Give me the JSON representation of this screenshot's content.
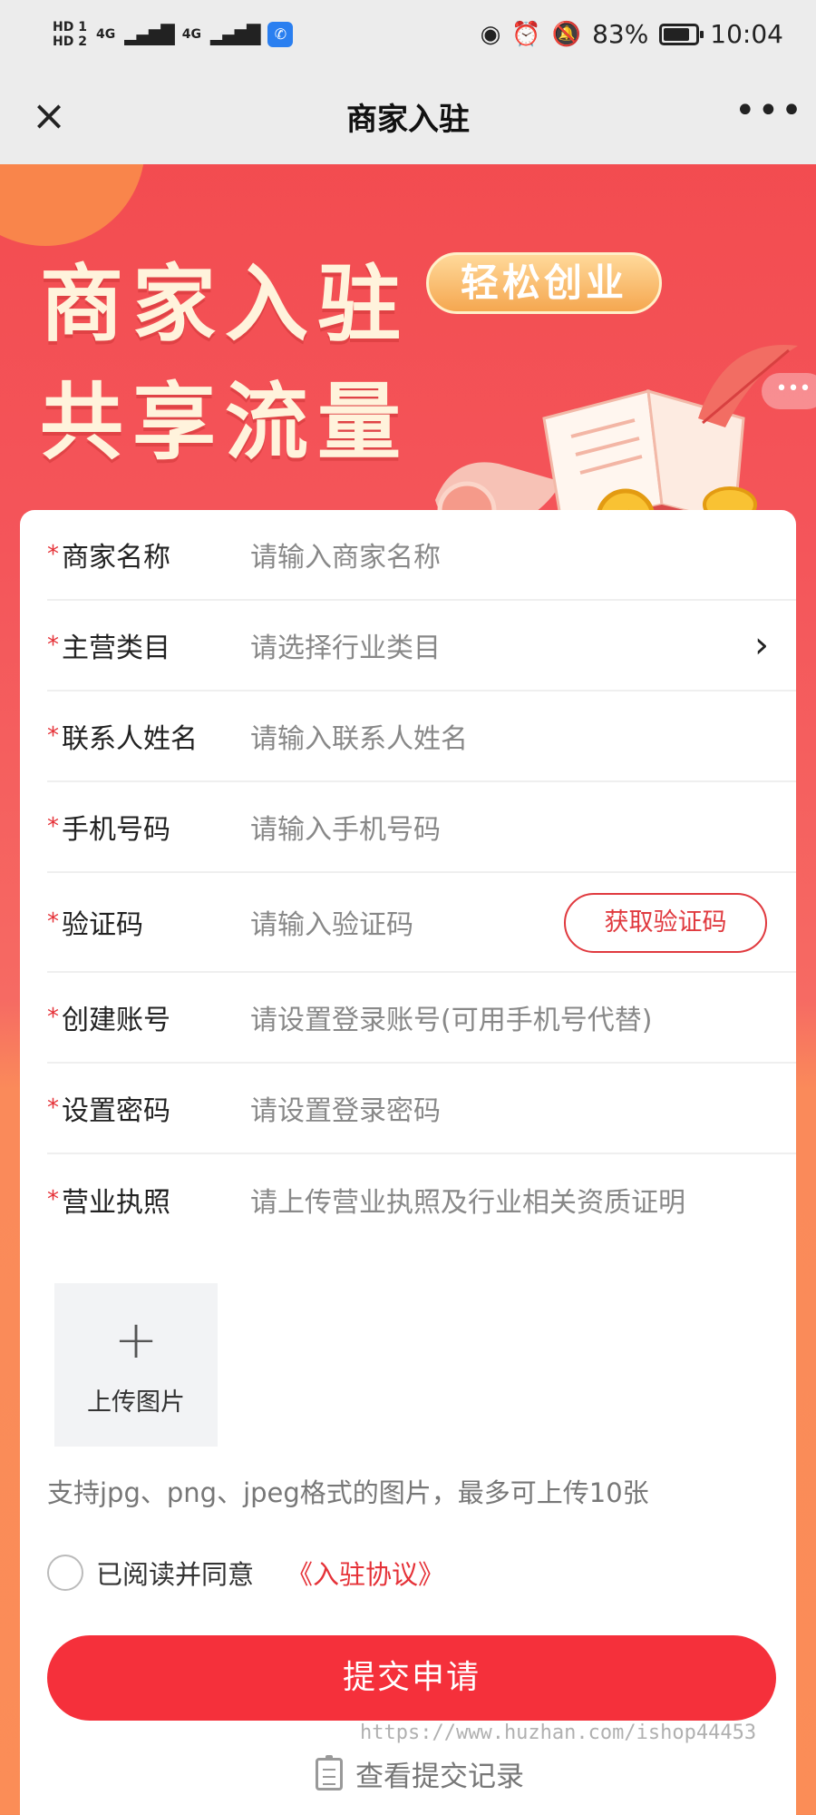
{
  "status_bar": {
    "hd1": "HD 1",
    "hd2": "HD 2",
    "signal1": "4G",
    "signal2": "4G",
    "battery_percent": "83%",
    "battery_level": 0.83,
    "time": "10:04",
    "icons": [
      "eye-icon",
      "alarm-icon",
      "mute-bell-icon"
    ]
  },
  "nav": {
    "title": "商家入驻",
    "close_icon": "×",
    "more_icon": "•••"
  },
  "banner": {
    "line1": "商家入驻",
    "badge": "轻松创业",
    "line2": "共享流量",
    "more_icon": "•••"
  },
  "form": {
    "rows": [
      {
        "label": "商家名称",
        "placeholder": "请输入商家名称"
      },
      {
        "label": "主营类目",
        "placeholder": "请选择行业类目"
      },
      {
        "label": "联系人姓名",
        "placeholder": "请输入联系人姓名"
      },
      {
        "label": "手机号码",
        "placeholder": "请输入手机号码"
      },
      {
        "label": "验证码",
        "placeholder": "请输入验证码"
      },
      {
        "label": "创建账号",
        "placeholder": "请设置登录账号(可用手机号代替)"
      },
      {
        "label": "设置密码",
        "placeholder": "请设置登录密码"
      },
      {
        "label": "营业执照",
        "placeholder": "请上传营业执照及行业相关资质证明"
      }
    ],
    "required_mark": "*",
    "code_button": "获取验证码",
    "chevron": "›"
  },
  "upload": {
    "plus": "+",
    "label": "上传图片",
    "hint": "支持jpg、png、jpeg格式的图片，最多可上传10张"
  },
  "agreement": {
    "text": "已阅读并同意",
    "link": "《入驻协议》"
  },
  "submit_label": "提交申请",
  "records_label": "查看提交记录",
  "watermark": "https://www.huzhan.com/ishop44453",
  "colors": {
    "primary_red": "#f5303b",
    "banner_red": "#f2484c",
    "banner_text": "#fff3dc",
    "required_red": "#e53238"
  }
}
